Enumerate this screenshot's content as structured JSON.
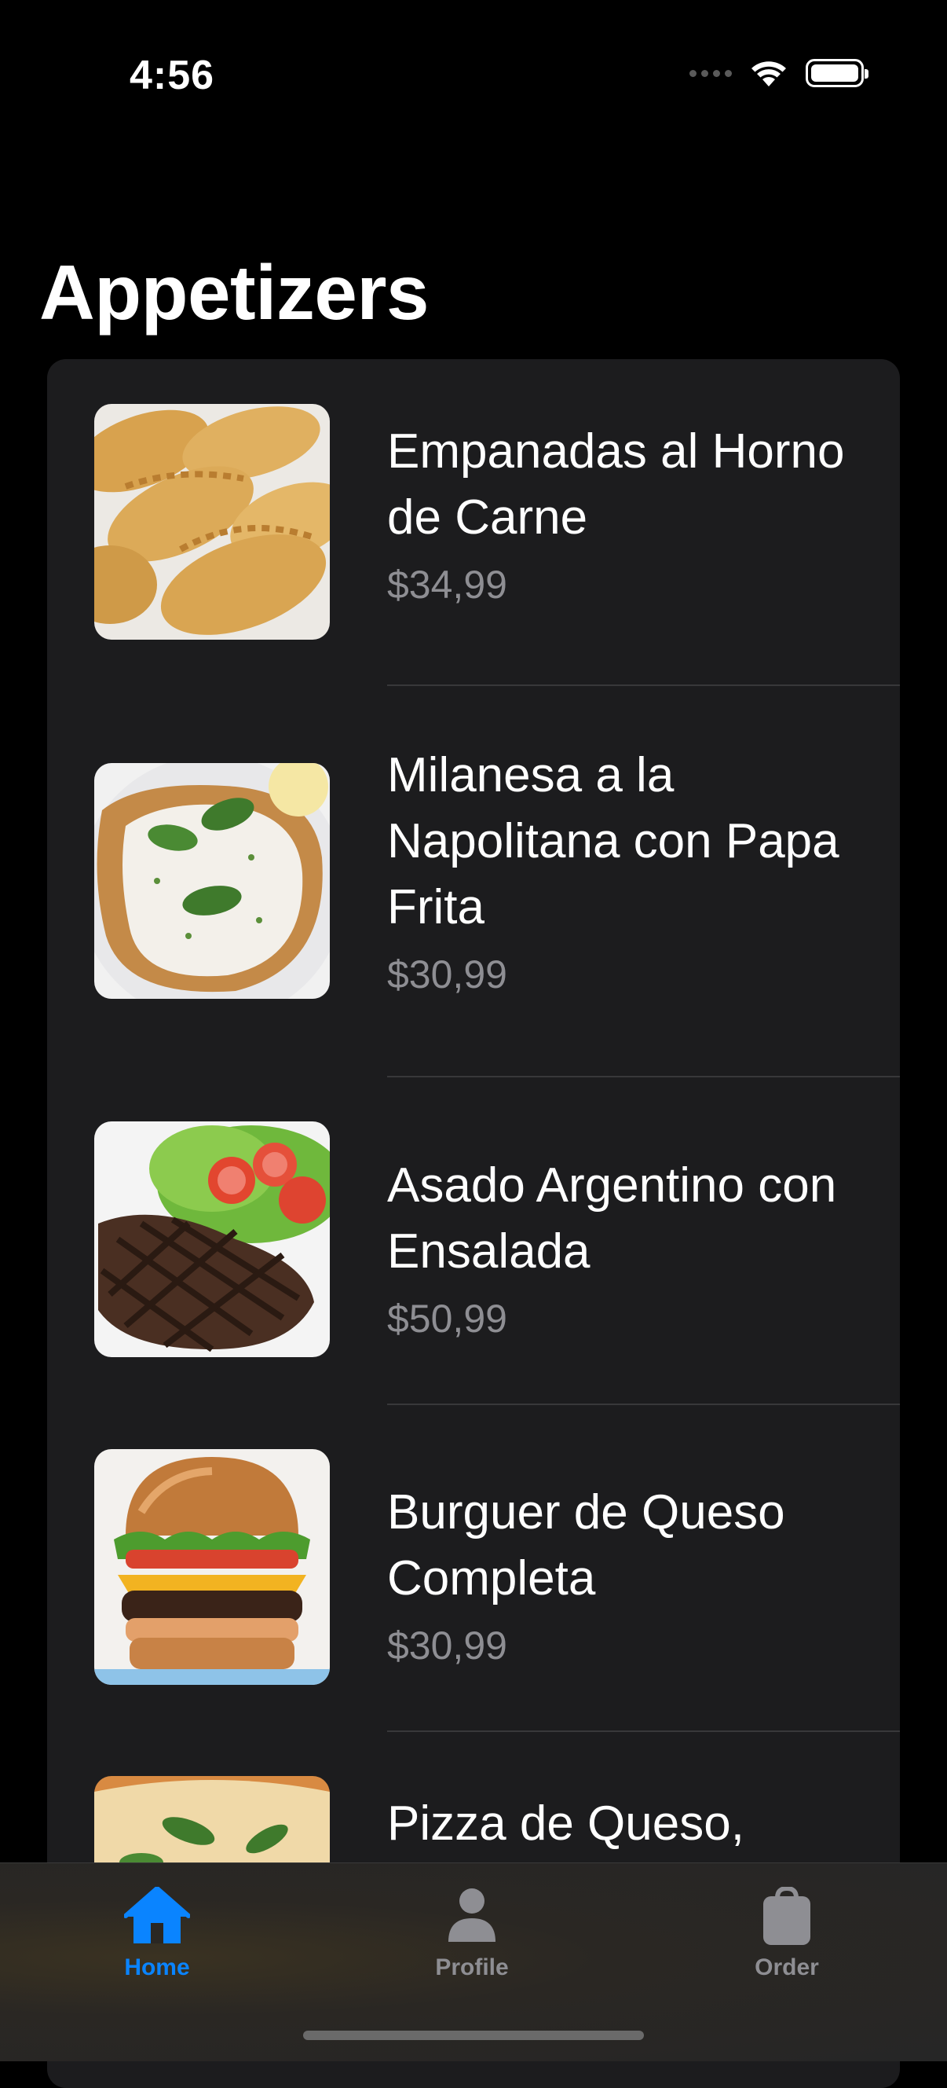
{
  "status_bar": {
    "time": "4:56",
    "icons": [
      "cellular-dots-icon",
      "wifi-icon",
      "battery-icon"
    ]
  },
  "page": {
    "title": "Appetizers"
  },
  "items": [
    {
      "name": "Empanadas al Horno de Carne",
      "price": "$34,99",
      "image": "empanadas-image"
    },
    {
      "name": "Milanesa a la Napolitana con Papa Frita",
      "price": "$30,99",
      "image": "milanesa-image"
    },
    {
      "name": "Asado Argentino con Ensalada",
      "price": "$50,99",
      "image": "asado-image"
    },
    {
      "name": "Burguer de Queso Completa",
      "price": "$30,99",
      "image": "burger-image"
    },
    {
      "name": "Pizza de Queso,",
      "price": "",
      "image": "pizza-image"
    }
  ],
  "tab_bar": {
    "tabs": [
      {
        "label": "Home",
        "icon": "house-icon",
        "active": true
      },
      {
        "label": "Profile",
        "icon": "person-icon",
        "active": false
      },
      {
        "label": "Order",
        "icon": "bag-icon",
        "active": false
      }
    ],
    "accent_color": "#0a84ff",
    "inactive_color": "#8e8e93"
  }
}
